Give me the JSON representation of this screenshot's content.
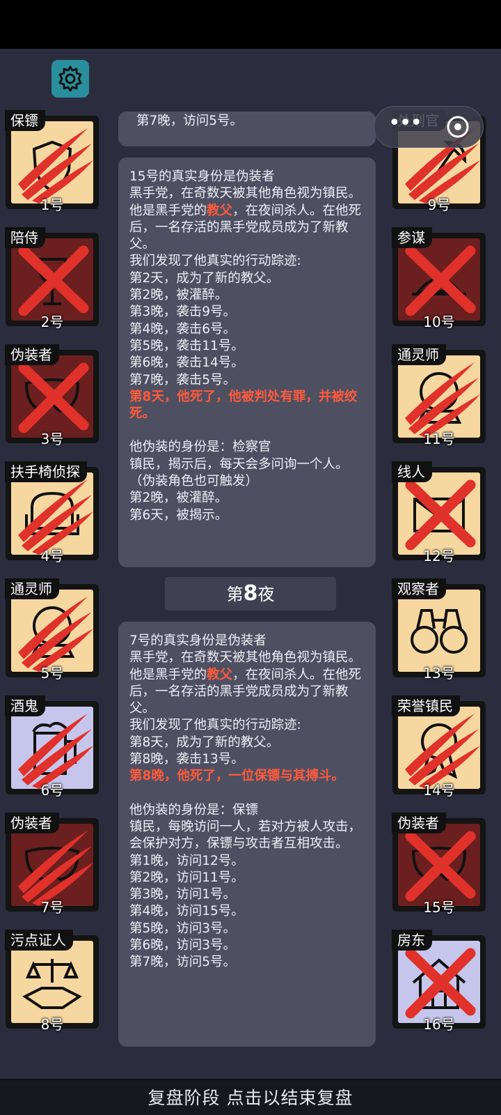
{
  "footer": {
    "label": "复盘阶段 点击以结束复盘"
  },
  "night_banner": {
    "prefix": "第",
    "number": "8",
    "suffix": "夜"
  },
  "capsule": {
    "more": "•••"
  },
  "players": [
    {
      "role": "保镖",
      "number": "1号",
      "state": "killed",
      "color": "tan",
      "icon": "shield-icon"
    },
    {
      "role": "陪侍",
      "number": "2号",
      "state": "executed",
      "color": "dead",
      "icon": "wine-glass-icon"
    },
    {
      "role": "伪装者",
      "number": "3号",
      "state": "executed",
      "color": "dead",
      "icon": "mask-icon"
    },
    {
      "role": "扶手椅侦探",
      "number": "4号",
      "state": "killed",
      "color": "tan",
      "icon": "armchair-icon"
    },
    {
      "role": "通灵师",
      "number": "5号",
      "state": "killed",
      "color": "tan",
      "icon": "crystal-ball-icon"
    },
    {
      "role": "酒鬼",
      "number": "6号",
      "state": "killed",
      "color": "lav",
      "icon": "beer-mug-icon"
    },
    {
      "role": "伪装者",
      "number": "7号",
      "state": "killed",
      "color": "dead",
      "icon": "mask-icon"
    },
    {
      "role": "污点证人",
      "number": "8号",
      "state": "alive",
      "color": "tan",
      "icon": "scales-handshake-icon"
    },
    {
      "role": "处刑官",
      "number": "9号",
      "state": "killed",
      "color": "tan",
      "icon": "axe-icon"
    },
    {
      "role": "参谋",
      "number": "10号",
      "state": "executed",
      "color": "dead",
      "icon": "hat-icon"
    },
    {
      "role": "通灵师",
      "number": "11号",
      "state": "killed",
      "color": "tan",
      "icon": "crystal-ball-icon"
    },
    {
      "role": "线人",
      "number": "12号",
      "state": "executed",
      "color": "tan",
      "icon": "envelope-icon"
    },
    {
      "role": "观察者",
      "number": "13号",
      "state": "alive",
      "color": "tan",
      "icon": "binoculars-icon"
    },
    {
      "role": "荣誉镇民",
      "number": "14号",
      "state": "killed",
      "color": "tan",
      "icon": "medal-icon"
    },
    {
      "role": "伪装者",
      "number": "15号",
      "state": "executed",
      "color": "dead",
      "icon": "mask-icon"
    },
    {
      "role": "房东",
      "number": "16号",
      "state": "executed",
      "color": "lav",
      "icon": "house-icon"
    }
  ],
  "log_top_partial": {
    "text": "第7晚，访问5号。"
  },
  "log_15": {
    "p1": "15号的真实身份是伪装者\n黑手党，在奇数天被其他角色视为镇民。\n他是黑手党的",
    "p1_red": "教父",
    "p1_tail": "，在夜间杀人。在他死后，一名存活的黑手党成员成为了新教父。\n我们发现了他真实的行动踪迹:\n第2天，成为了新的教父。\n第2晚，被灌醉。\n第3晚，袭击9号。\n第4晚，袭击6号。\n第5晚，袭击11号。\n第6晚，袭击14号。\n第7晚，袭击5号。",
    "death": "第8天，他死了，他被判处有罪，并被绞死。",
    "p2": "他伪装的身份是：检察官\n镇民，揭示后，每天会多问询一个人。（伪装角色也可触发）\n第2晚，被灌醉。\n第6天，被揭示。"
  },
  "log_7": {
    "p1": "7号的真实身份是伪装者\n黑手党，在奇数天被其他角色视为镇民。\n他是黑手党的",
    "p1_red": "教父",
    "p1_tail": "，在夜间杀人。在他死后，一名存活的黑手党成员成为了新教父。\n我们发现了他真实的行动踪迹:\n第8天，成为了新的教父。\n第8晚，袭击13号。",
    "death": "第8晚，他死了，一位保镖与其搏斗。",
    "p2": "他伪装的身份是：保镖\n镇民，每晚访问一人，若对方被人攻击，会保护对方，保镖与攻击者互相攻击。\n第1晚，访问12号。\n第2晚，访问11号。\n第3晚，访问1号。\n第4晚，访问15号。\n第5晚，访问3号。\n第6晚，访问3号。\n第7晚，访问5号。"
  },
  "colors": {
    "background": "#2b2d3e",
    "card": "#4e5062",
    "tan": "#f6d79f",
    "dead": "#6b1f1f",
    "lavender": "#c6c6ec",
    "red_text": "#ff5a3c",
    "x_mark": "#e0312a",
    "gear_button": "#2a8f9c"
  }
}
